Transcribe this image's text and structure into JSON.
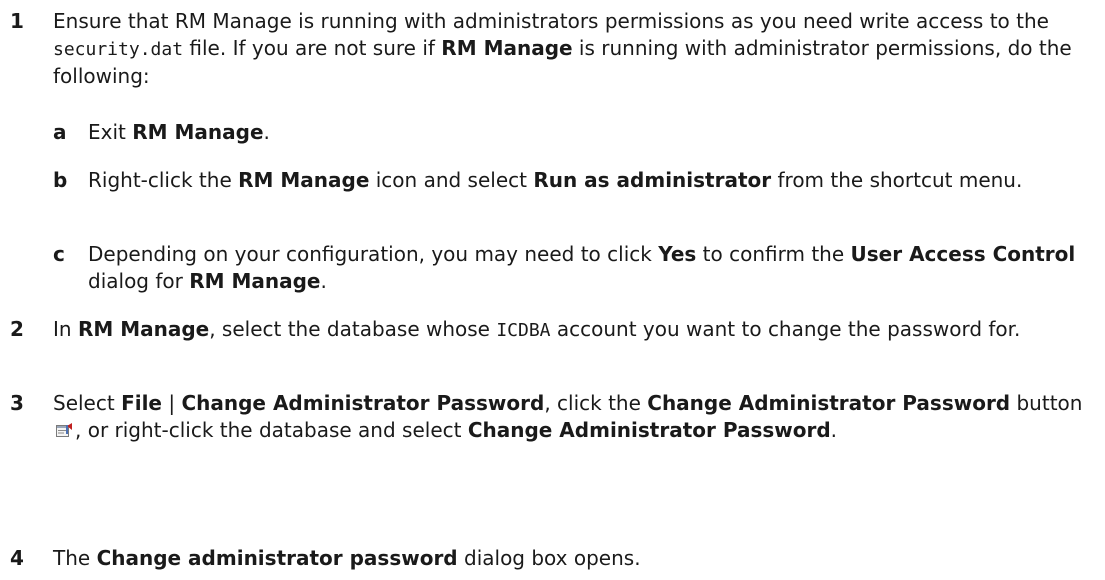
{
  "steps": [
    {
      "num": "1",
      "parts": [
        "Ensure that RM Manage is running with administrators permissions as you need write access to the ",
        "security.dat",
        " file. If you are not sure if ",
        "RM Manage",
        " is running with administrator permissions, do the following:"
      ],
      "substeps": [
        {
          "letter": "a",
          "parts": [
            "Exit ",
            "RM Manage",
            "."
          ]
        },
        {
          "letter": "b",
          "parts": [
            "Right-click the ",
            "RM Manage",
            " icon and select ",
            "Run as administrator",
            " from the shortcut menu."
          ]
        },
        {
          "letter": "c",
          "parts": [
            "Depending on your configuration, you may need to click ",
            "Yes",
            " to confirm the ",
            "User Access Control",
            " dialog for ",
            "RM Manage",
            "."
          ]
        }
      ]
    },
    {
      "num": "2",
      "parts": [
        "In ",
        "RM Manage",
        ", select the database whose ",
        "ICDBA",
        " account you want to change the password for."
      ]
    },
    {
      "num": "3",
      "parts": [
        "Select ",
        "File",
        " | ",
        "Change Administrator Password",
        ", click the ",
        "Change Administrator Password",
        " button ",
        ", or right-click the database and select ",
        "Change Administrator Password",
        "."
      ]
    },
    {
      "num": "4",
      "parts": [
        "The ",
        "Change administrator password",
        " dialog box opens."
      ]
    }
  ],
  "icons": {
    "change_password_button": "change-admin-password-icon"
  }
}
